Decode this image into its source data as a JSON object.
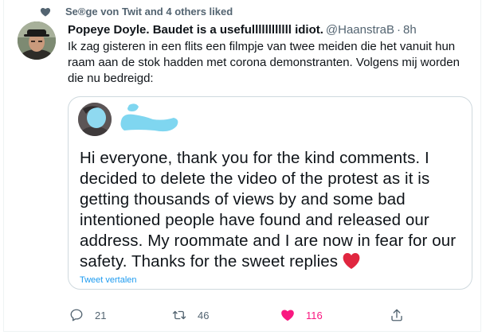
{
  "social_context": {
    "text": "Se®ge von Twit and 4 others liked",
    "icon": "heart-icon",
    "color": "#536471"
  },
  "tweet": {
    "display_name": "Popeye Doyle. Baudet is a usefullllllllllll idiot.",
    "handle": "@HaanstraB",
    "separator": "·",
    "time": "8h",
    "text": "Ik zag gisteren in een flits een filmpje van twee meiden die het vanuit hun raam aan de stok hadden met corona demonstranten. Volgens mij worden die nu bedreigd:"
  },
  "quote": {
    "text": "Hi everyone, thank you for the kind comments. I decided to delete the video of the protest as it is getting thousands of views by and some bad intentioned people have found and released our address. My roommate and I are now in fear for our safety. Thanks for the sweet replies",
    "emoji": "red-heart",
    "translate_label": "Tweet vertalen",
    "blur_color": "#7fd6f0"
  },
  "actions": {
    "reply_count": "21",
    "retweet_count": "46",
    "like_count": "116",
    "like_color": "#f91880"
  },
  "colors": {
    "text": "#0f1419",
    "muted": "#536471",
    "link": "#1d9bf0",
    "border": "#cfd9de"
  }
}
